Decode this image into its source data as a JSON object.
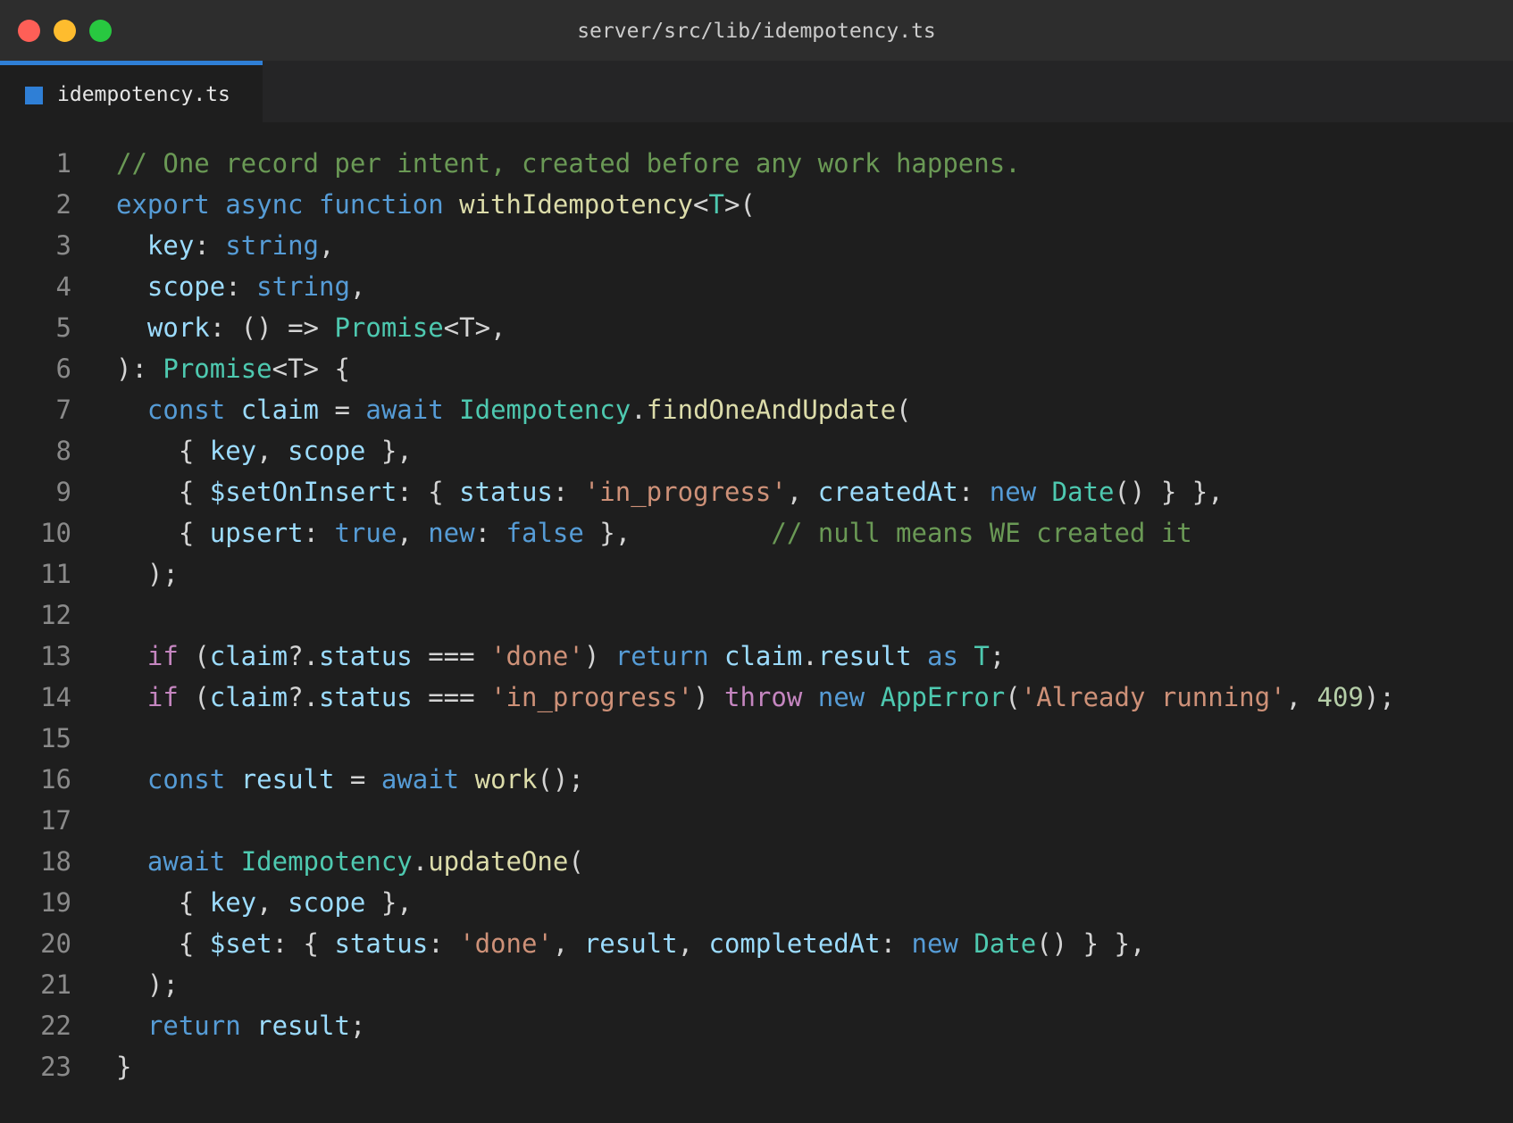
{
  "window": {
    "title": "server/src/lib/idempotency.ts"
  },
  "tab": {
    "label": "idempotency.ts",
    "icon": "typescript-file-icon"
  },
  "colors": {
    "comment": "#6a9955",
    "keyword": "#569cd6",
    "control": "#c586c0",
    "type": "#4ec9b0",
    "function": "#dcdcaa",
    "variable": "#9cdcfe",
    "string": "#ce9178",
    "number": "#b5cea8",
    "punctuation": "#d4d4d4",
    "accent": "#2f7fd6"
  },
  "code_lines": [
    {
      "n": "1",
      "tokens": [
        [
          "comment",
          "// One record per intent, created before any work happens."
        ]
      ]
    },
    {
      "n": "2",
      "tokens": [
        [
          "keyword",
          "export async function "
        ],
        [
          "function",
          "withIdempotency"
        ],
        [
          "punctuation",
          "<"
        ],
        [
          "type",
          "T"
        ],
        [
          "punctuation",
          ">("
        ]
      ]
    },
    {
      "n": "3",
      "tokens": [
        [
          "punctuation",
          "  "
        ],
        [
          "variable",
          "key"
        ],
        [
          "punctuation",
          ": "
        ],
        [
          "keyword",
          "string"
        ],
        [
          "punctuation",
          ","
        ]
      ]
    },
    {
      "n": "4",
      "tokens": [
        [
          "punctuation",
          "  "
        ],
        [
          "variable",
          "scope"
        ],
        [
          "punctuation",
          ": "
        ],
        [
          "keyword",
          "string"
        ],
        [
          "punctuation",
          ","
        ]
      ]
    },
    {
      "n": "5",
      "tokens": [
        [
          "punctuation",
          "  "
        ],
        [
          "variable",
          "work"
        ],
        [
          "punctuation",
          ": () => "
        ],
        [
          "type",
          "Promise"
        ],
        [
          "punctuation",
          "<T>,"
        ]
      ]
    },
    {
      "n": "6",
      "tokens": [
        [
          "punctuation",
          "): "
        ],
        [
          "type",
          "Promise"
        ],
        [
          "punctuation",
          "<T> {"
        ]
      ]
    },
    {
      "n": "7",
      "tokens": [
        [
          "punctuation",
          "  "
        ],
        [
          "keyword",
          "const "
        ],
        [
          "variable",
          "claim"
        ],
        [
          "punctuation",
          " = "
        ],
        [
          "keyword",
          "await "
        ],
        [
          "type",
          "Idempotency"
        ],
        [
          "punctuation",
          "."
        ],
        [
          "function",
          "findOneAndUpdate"
        ],
        [
          "punctuation",
          "("
        ]
      ]
    },
    {
      "n": "8",
      "tokens": [
        [
          "punctuation",
          "    { "
        ],
        [
          "variable",
          "key"
        ],
        [
          "punctuation",
          ", "
        ],
        [
          "variable",
          "scope"
        ],
        [
          "punctuation",
          " },"
        ]
      ]
    },
    {
      "n": "9",
      "tokens": [
        [
          "punctuation",
          "    { "
        ],
        [
          "variable",
          "$setOnInsert"
        ],
        [
          "punctuation",
          ": { "
        ],
        [
          "variable",
          "status"
        ],
        [
          "punctuation",
          ": "
        ],
        [
          "string",
          "'in_progress'"
        ],
        [
          "punctuation",
          ", "
        ],
        [
          "variable",
          "createdAt"
        ],
        [
          "punctuation",
          ": "
        ],
        [
          "keyword",
          "new "
        ],
        [
          "type",
          "Date"
        ],
        [
          "punctuation",
          "() } },"
        ]
      ]
    },
    {
      "n": "10",
      "tokens": [
        [
          "punctuation",
          "    { "
        ],
        [
          "variable",
          "upsert"
        ],
        [
          "punctuation",
          ": "
        ],
        [
          "keyword",
          "true"
        ],
        [
          "punctuation",
          ", "
        ],
        [
          "keyword",
          "new"
        ],
        [
          "punctuation",
          ": "
        ],
        [
          "keyword",
          "false"
        ],
        [
          "punctuation",
          " },         "
        ],
        [
          "comment",
          "// null means WE created it"
        ]
      ]
    },
    {
      "n": "11",
      "tokens": [
        [
          "punctuation",
          "  );"
        ]
      ]
    },
    {
      "n": "12",
      "tokens": []
    },
    {
      "n": "13",
      "tokens": [
        [
          "punctuation",
          "  "
        ],
        [
          "control",
          "if"
        ],
        [
          "punctuation",
          " ("
        ],
        [
          "variable",
          "claim"
        ],
        [
          "punctuation",
          "?."
        ],
        [
          "variable",
          "status"
        ],
        [
          "punctuation",
          " === "
        ],
        [
          "string",
          "'done'"
        ],
        [
          "punctuation",
          ") "
        ],
        [
          "keyword",
          "return "
        ],
        [
          "variable",
          "claim"
        ],
        [
          "punctuation",
          "."
        ],
        [
          "variable",
          "result"
        ],
        [
          "punctuation",
          " "
        ],
        [
          "keyword",
          "as "
        ],
        [
          "type",
          "T"
        ],
        [
          "punctuation",
          ";"
        ]
      ]
    },
    {
      "n": "14",
      "tokens": [
        [
          "punctuation",
          "  "
        ],
        [
          "control",
          "if"
        ],
        [
          "punctuation",
          " ("
        ],
        [
          "variable",
          "claim"
        ],
        [
          "punctuation",
          "?."
        ],
        [
          "variable",
          "status"
        ],
        [
          "punctuation",
          " === "
        ],
        [
          "string",
          "'in_progress'"
        ],
        [
          "punctuation",
          ") "
        ],
        [
          "control",
          "throw "
        ],
        [
          "keyword",
          "new "
        ],
        [
          "type",
          "AppError"
        ],
        [
          "punctuation",
          "("
        ],
        [
          "string",
          "'Already running'"
        ],
        [
          "punctuation",
          ", "
        ],
        [
          "number",
          "409"
        ],
        [
          "punctuation",
          ");"
        ]
      ]
    },
    {
      "n": "15",
      "tokens": []
    },
    {
      "n": "16",
      "tokens": [
        [
          "punctuation",
          "  "
        ],
        [
          "keyword",
          "const "
        ],
        [
          "variable",
          "result"
        ],
        [
          "punctuation",
          " = "
        ],
        [
          "keyword",
          "await "
        ],
        [
          "function",
          "work"
        ],
        [
          "punctuation",
          "();"
        ]
      ]
    },
    {
      "n": "17",
      "tokens": []
    },
    {
      "n": "18",
      "tokens": [
        [
          "punctuation",
          "  "
        ],
        [
          "keyword",
          "await "
        ],
        [
          "type",
          "Idempotency"
        ],
        [
          "punctuation",
          "."
        ],
        [
          "function",
          "updateOne"
        ],
        [
          "punctuation",
          "("
        ]
      ]
    },
    {
      "n": "19",
      "tokens": [
        [
          "punctuation",
          "    { "
        ],
        [
          "variable",
          "key"
        ],
        [
          "punctuation",
          ", "
        ],
        [
          "variable",
          "scope"
        ],
        [
          "punctuation",
          " },"
        ]
      ]
    },
    {
      "n": "20",
      "tokens": [
        [
          "punctuation",
          "    { "
        ],
        [
          "variable",
          "$set"
        ],
        [
          "punctuation",
          ": { "
        ],
        [
          "variable",
          "status"
        ],
        [
          "punctuation",
          ": "
        ],
        [
          "string",
          "'done'"
        ],
        [
          "punctuation",
          ", "
        ],
        [
          "variable",
          "result"
        ],
        [
          "punctuation",
          ", "
        ],
        [
          "variable",
          "completedAt"
        ],
        [
          "punctuation",
          ": "
        ],
        [
          "keyword",
          "new "
        ],
        [
          "type",
          "Date"
        ],
        [
          "punctuation",
          "() } },"
        ]
      ]
    },
    {
      "n": "21",
      "tokens": [
        [
          "punctuation",
          "  );"
        ]
      ]
    },
    {
      "n": "22",
      "tokens": [
        [
          "punctuation",
          "  "
        ],
        [
          "keyword",
          "return "
        ],
        [
          "variable",
          "result"
        ],
        [
          "punctuation",
          ";"
        ]
      ]
    },
    {
      "n": "23",
      "tokens": [
        [
          "punctuation",
          "}"
        ]
      ]
    }
  ]
}
